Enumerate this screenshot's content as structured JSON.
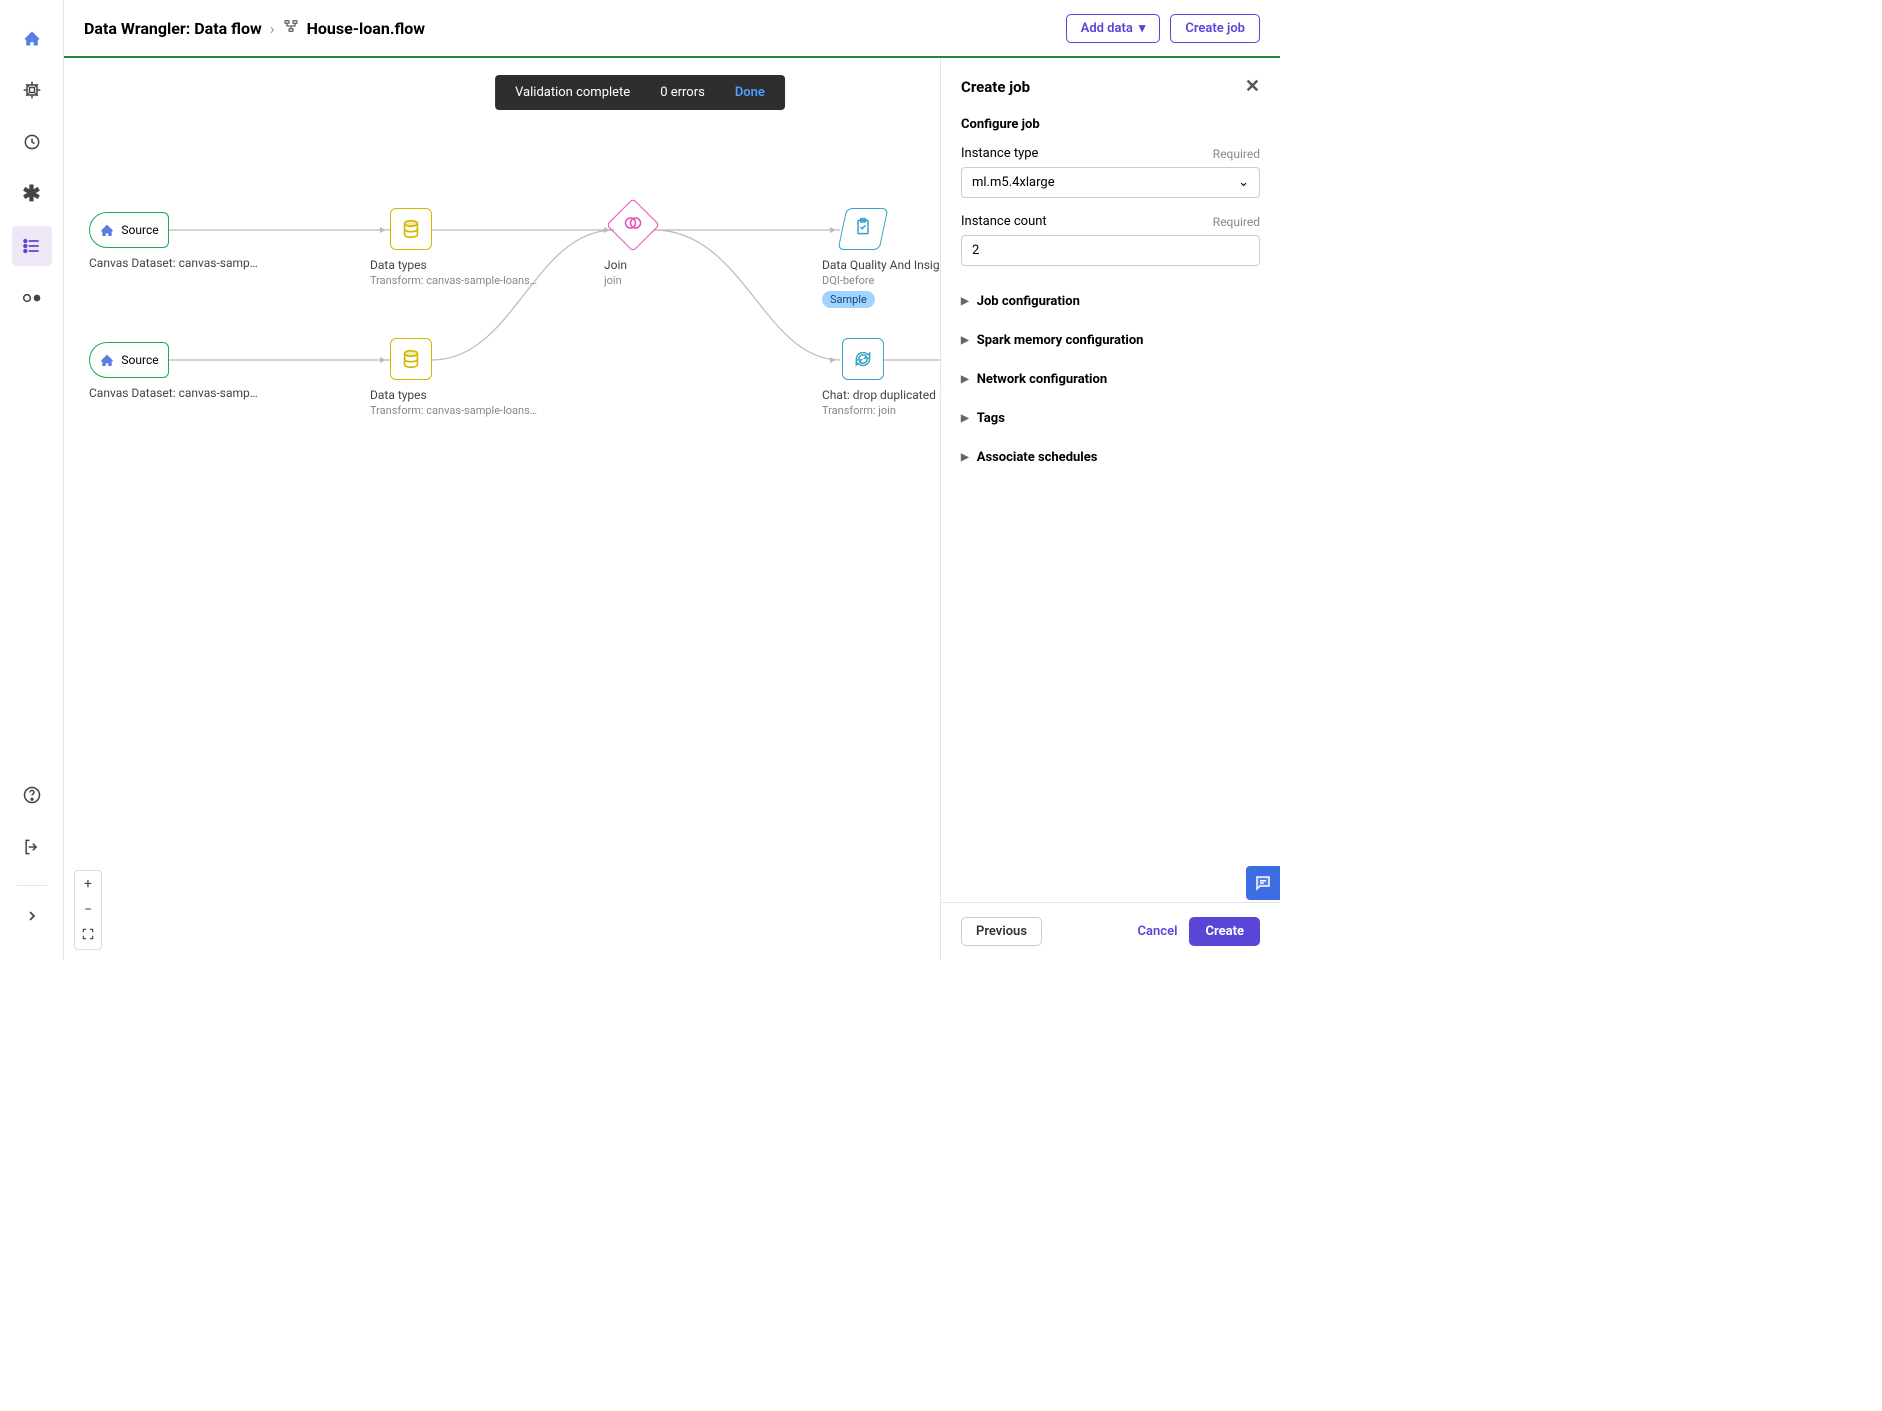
{
  "leftRail": {
    "items": [
      {
        "name": "home-icon"
      },
      {
        "name": "processor-icon"
      },
      {
        "name": "autopilot-icon"
      },
      {
        "name": "graph-icon"
      },
      {
        "name": "list-icon",
        "active": true
      },
      {
        "name": "pipeline-icon"
      }
    ],
    "bottom": [
      {
        "name": "help-icon"
      },
      {
        "name": "signout-icon"
      },
      {
        "name": "expand-icon"
      }
    ]
  },
  "breadcrumb": {
    "root": "Data Wrangler: Data flow",
    "flow": "House-loan.flow"
  },
  "header": {
    "addData": "Add data",
    "createJob": "Create job"
  },
  "toast": {
    "message": "Validation complete",
    "errors": "0 errors",
    "done": "Done"
  },
  "nodes": {
    "source1": {
      "title": "Source",
      "sub": "Canvas Dataset: canvas-sample-loans-…"
    },
    "source2": {
      "title": "Source",
      "sub": "Canvas Dataset: canvas-sample-loans-…"
    },
    "types1": {
      "title": "Data types",
      "sub": "Transform: canvas-sample-loans-part-…"
    },
    "types2": {
      "title": "Data types",
      "sub": "Transform: canvas-sample-loans-part-…"
    },
    "join": {
      "title": "Join",
      "sub": "join"
    },
    "dqi": {
      "title": "Data Quality And Insights Report",
      "sub": "DQI-before",
      "badge": "Sample"
    },
    "chat": {
      "title": "Chat: drop duplicated ID",
      "sub": "Transform: join"
    }
  },
  "rightPanel": {
    "title": "Create job",
    "configure": "Configure job",
    "instanceType": {
      "label": "Instance type",
      "required": "Required",
      "value": "ml.m5.4xlarge"
    },
    "instanceCount": {
      "label": "Instance count",
      "required": "Required",
      "value": "2"
    },
    "sections": [
      "Job configuration",
      "Spark memory configuration",
      "Network configuration",
      "Tags",
      "Associate schedules"
    ],
    "footer": {
      "previous": "Previous",
      "cancel": "Cancel",
      "create": "Create"
    }
  }
}
